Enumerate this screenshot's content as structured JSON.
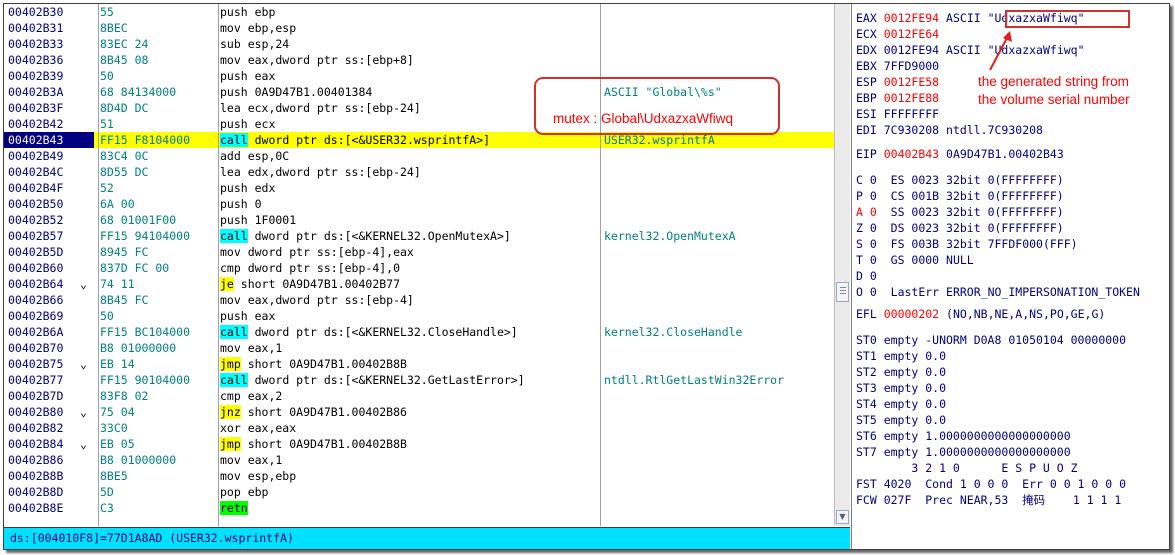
{
  "disassembly": {
    "rows": [
      {
        "addr": "00402B30",
        "arrow": "",
        "hex": "55",
        "asm": "push ebp",
        "comment": ""
      },
      {
        "addr": "00402B31",
        "arrow": "",
        "hex": "8BEC",
        "asm": "mov ebp,esp",
        "comment": ""
      },
      {
        "addr": "00402B33",
        "arrow": "",
        "hex": "83EC 24",
        "asm": "sub esp,24",
        "comment": ""
      },
      {
        "addr": "00402B36",
        "arrow": "",
        "hex": "8B45 08",
        "asm": "mov eax,dword ptr ss:[ebp+8]",
        "comment": ""
      },
      {
        "addr": "00402B39",
        "arrow": "",
        "hex": "50",
        "asm": "push eax",
        "comment": ""
      },
      {
        "addr": "00402B3A",
        "arrow": "",
        "hex": "68 84134000",
        "asm": "push 0A9D47B1.00401384",
        "comment": "ASCII \"Global\\%s\""
      },
      {
        "addr": "00402B3F",
        "arrow": "",
        "hex": "8D4D DC",
        "asm": "lea ecx,dword ptr ss:[ebp-24]",
        "comment": ""
      },
      {
        "addr": "00402B42",
        "arrow": "",
        "hex": "51",
        "asm": "push ecx",
        "comment": ""
      },
      {
        "addr": "00402B43",
        "arrow": "",
        "hex": "FF15 F8104000",
        "kw": "call",
        "asm": " dword ptr ds:[<&USER32.wsprintfA>]",
        "comment": "USER32.wsprintfA"
      },
      {
        "addr": "00402B49",
        "arrow": "",
        "hex": "83C4 0C",
        "asm": "add esp,0C",
        "comment": ""
      },
      {
        "addr": "00402B4C",
        "arrow": "",
        "hex": "8D55 DC",
        "asm": "lea edx,dword ptr ss:[ebp-24]",
        "comment": ""
      },
      {
        "addr": "00402B4F",
        "arrow": "",
        "hex": "52",
        "asm": "push edx",
        "comment": ""
      },
      {
        "addr": "00402B50",
        "arrow": "",
        "hex": "6A 00",
        "asm": "push 0",
        "comment": ""
      },
      {
        "addr": "00402B52",
        "arrow": "",
        "hex": "68 01001F00",
        "asm": "push 1F0001",
        "comment": ""
      },
      {
        "addr": "00402B57",
        "arrow": "",
        "hex": "FF15 94104000",
        "kw": "call",
        "asm": " dword ptr ds:[<&KERNEL32.OpenMutexA>]",
        "comment": "kernel32.OpenMutexA"
      },
      {
        "addr": "00402B5D",
        "arrow": "",
        "hex": "8945 FC",
        "asm": "mov dword ptr ss:[ebp-4],eax",
        "comment": ""
      },
      {
        "addr": "00402B60",
        "arrow": "",
        "hex": "837D FC 00",
        "asm": "cmp dword ptr ss:[ebp-4],0",
        "comment": ""
      },
      {
        "addr": "00402B64",
        "arrow": "⌄",
        "hex": "74 11",
        "kw": "je",
        "asm": " short 0A9D47B1.00402B77",
        "comment": ""
      },
      {
        "addr": "00402B66",
        "arrow": "",
        "hex": "8B45 FC",
        "asm": "mov eax,dword ptr ss:[ebp-4]",
        "comment": ""
      },
      {
        "addr": "00402B69",
        "arrow": "",
        "hex": "50",
        "asm": "push eax",
        "comment": ""
      },
      {
        "addr": "00402B6A",
        "arrow": "",
        "hex": "FF15 BC104000",
        "kw": "call",
        "asm": " dword ptr ds:[<&KERNEL32.CloseHandle>]",
        "comment": "kernel32.CloseHandle"
      },
      {
        "addr": "00402B70",
        "arrow": "",
        "hex": "B8 01000000",
        "asm": "mov eax,1",
        "comment": ""
      },
      {
        "addr": "00402B75",
        "arrow": "⌄",
        "hex": "EB 14",
        "kw": "jmp",
        "asm": " short 0A9D47B1.00402B8B",
        "comment": ""
      },
      {
        "addr": "00402B77",
        "arrow": "",
        "hex": "FF15 90104000",
        "kw": "call",
        "asm": " dword ptr ds:[<&KERNEL32.GetLastError>]",
        "comment": "ntdll.RtlGetLastWin32Error"
      },
      {
        "addr": "00402B7D",
        "arrow": "",
        "hex": "83F8 02",
        "asm": "cmp eax,2",
        "comment": ""
      },
      {
        "addr": "00402B80",
        "arrow": "⌄",
        "hex": "75 04",
        "kw": "jnz",
        "asm": " short 0A9D47B1.00402B86",
        "comment": ""
      },
      {
        "addr": "00402B82",
        "arrow": "",
        "hex": "33C0",
        "asm": "xor eax,eax",
        "comment": ""
      },
      {
        "addr": "00402B84",
        "arrow": "⌄",
        "hex": "EB 05",
        "kw": "jmp",
        "asm": " short 0A9D47B1.00402B8B",
        "comment": ""
      },
      {
        "addr": "00402B86",
        "arrow": "",
        "hex": "B8 01000000",
        "asm": "mov eax,1",
        "comment": ""
      },
      {
        "addr": "00402B8B",
        "arrow": "",
        "hex": "8BE5",
        "asm": "mov esp,ebp",
        "comment": ""
      },
      {
        "addr": "00402B8D",
        "arrow": "",
        "hex": "5D",
        "asm": "pop ebp",
        "comment": ""
      },
      {
        "addr": "00402B8E",
        "arrow": "",
        "hex": "C3",
        "kw": "retn",
        "asm": "",
        "comment": ""
      }
    ]
  },
  "annotations": {
    "mutex_label": "mutex : Global\\UdxazxaWfiwq",
    "generated_note_line1": "the generated string from",
    "generated_note_line2": "the volume serial number"
  },
  "info_bar": {
    "text": "ds:[004010F8]=77D1A8AD (USER32.wsprintfA)"
  },
  "registers": {
    "eax": {
      "name": "EAX",
      "value": "0012FE94",
      "note": "ASCII \"UdxazxaWfiwq\""
    },
    "ecx": {
      "name": "ECX",
      "value": "0012FE64"
    },
    "edx": {
      "name": "EDX",
      "value": "0012FE94",
      "note": "ASCII \"UdxazxaWfiwq\""
    },
    "ebx": {
      "name": "EBX",
      "value": "7FFD9000"
    },
    "esp": {
      "name": "ESP",
      "value": "0012FE58"
    },
    "ebp": {
      "name": "EBP",
      "value": "0012FE88"
    },
    "esi": {
      "name": "ESI",
      "value": "FFFFFFFF"
    },
    "edi": {
      "name": "EDI",
      "value": "7C930208",
      "note": "ntdll.7C930208"
    },
    "eip": {
      "name": "EIP",
      "value": "00402B43",
      "note": "0A9D47B1.00402B43"
    },
    "flags": [
      {
        "flag": "C 0",
        "text": "ES 0023 32bit 0(FFFFFFFF)"
      },
      {
        "flag": "P 0",
        "text": "CS 001B 32bit 0(FFFFFFFF)"
      },
      {
        "flag": "A 0",
        "text": "SS 0023 32bit 0(FFFFFFFF)"
      },
      {
        "flag": "Z 0",
        "text": "DS 0023 32bit 0(FFFFFFFF)"
      },
      {
        "flag": "S 0",
        "text": "FS 003B 32bit 7FFDF000(FFF)"
      },
      {
        "flag": "T 0",
        "text": "GS 0000 NULL"
      },
      {
        "flag": "D 0",
        "text": ""
      },
      {
        "flag": "O 0",
        "text": "LastErr ERROR_NO_IMPERSONATION_TOKEN"
      }
    ],
    "efl": {
      "name": "EFL",
      "value": "00000202",
      "note": "(NO,NB,NE,A,NS,PO,GE,G)"
    },
    "fpu": [
      "ST0 empty -UNORM D0A8 01050104 00000000",
      "ST1 empty 0.0",
      "ST2 empty 0.0",
      "ST3 empty 0.0",
      "ST4 empty 0.0",
      "ST5 empty 0.0",
      "ST6 empty 1.0000000000000000000",
      "ST7 empty 1.0000000000000000000"
    ],
    "fpu_header": "        3 2 1 0      E S P U O Z",
    "fst": "FST 4020  Cond 1 0 0 0  Err 0 0 1 0 0 0",
    "fcw": "FCW 027F  Prec NEAR,53  掩码    1 1 1 1"
  },
  "colors": {
    "highlight": "#ffff00",
    "call": "#00ffff",
    "ret": "#00ff00",
    "address": "#000080",
    "hex": "#008080",
    "annotation": "#ff0000"
  }
}
